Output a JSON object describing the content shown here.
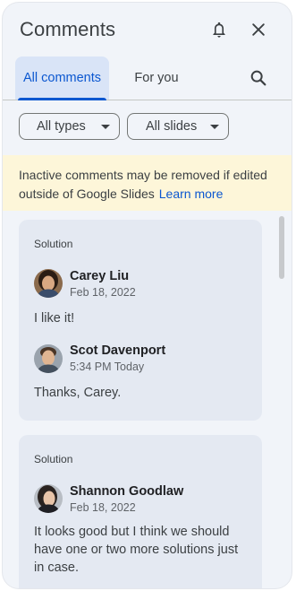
{
  "header": {
    "title": "Comments",
    "icons": [
      "bell-icon",
      "close-icon"
    ]
  },
  "tabs": [
    {
      "label": "All comments",
      "selected": true
    },
    {
      "label": "For you",
      "selected": false
    }
  ],
  "filters": [
    {
      "label": "All types"
    },
    {
      "label": "All slides"
    }
  ],
  "banner": {
    "text": "Inactive comments may be removed if edited outside of Google Slides",
    "link": "Learn more"
  },
  "threads": [
    {
      "label": "Solution",
      "comments": [
        {
          "author": "Carey Liu",
          "date": "Feb 18, 2022",
          "text": "I like it!"
        },
        {
          "author": "Scot Davenport",
          "date": "5:34 PM Today",
          "text": "Thanks, Carey."
        }
      ]
    },
    {
      "label": "Solution",
      "comments": [
        {
          "author": "Shannon Goodlaw",
          "date": "Feb 18, 2022",
          "text": "It looks good but I think we should have one or two more solutions just in case."
        }
      ]
    }
  ],
  "colors": {
    "accent": "#0b57d0",
    "selected_tab_bg": "#d9e4f7",
    "banner_bg": "#fdf6d9",
    "card_bg": "#e4e9f2",
    "panel_bg": "#f1f4f9"
  }
}
